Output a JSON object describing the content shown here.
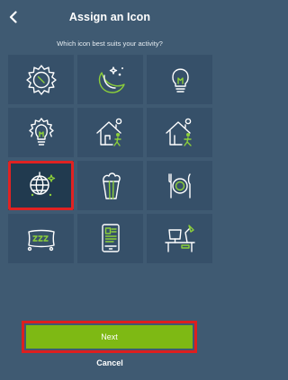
{
  "header": {
    "title": "Assign an Icon",
    "back_icon": "chevron-left-icon"
  },
  "prompt": "Which icon best suits your activity?",
  "icons": [
    {
      "name": "sun-icon",
      "selected": false
    },
    {
      "name": "moon-stars-icon",
      "selected": false
    },
    {
      "name": "lightbulb-icon",
      "selected": false
    },
    {
      "name": "lightbulb-glowing-icon",
      "selected": false
    },
    {
      "name": "house-arrive-icon",
      "selected": false
    },
    {
      "name": "house-leave-icon",
      "selected": false
    },
    {
      "name": "disco-ball-icon",
      "selected": true
    },
    {
      "name": "popcorn-icon",
      "selected": false
    },
    {
      "name": "plate-cutlery-icon",
      "selected": false
    },
    {
      "name": "pillow-sleep-icon",
      "selected": false
    },
    {
      "name": "tablet-reading-icon",
      "selected": false
    },
    {
      "name": "desk-lamp-icon",
      "selected": false
    }
  ],
  "buttons": {
    "next": "Next",
    "cancel": "Cancel"
  },
  "colors": {
    "background": "#3f5a72",
    "tile": "#365069",
    "accent_green": "#8ccf3a",
    "next_button": "#7eb914",
    "highlight_red": "#e02222"
  }
}
